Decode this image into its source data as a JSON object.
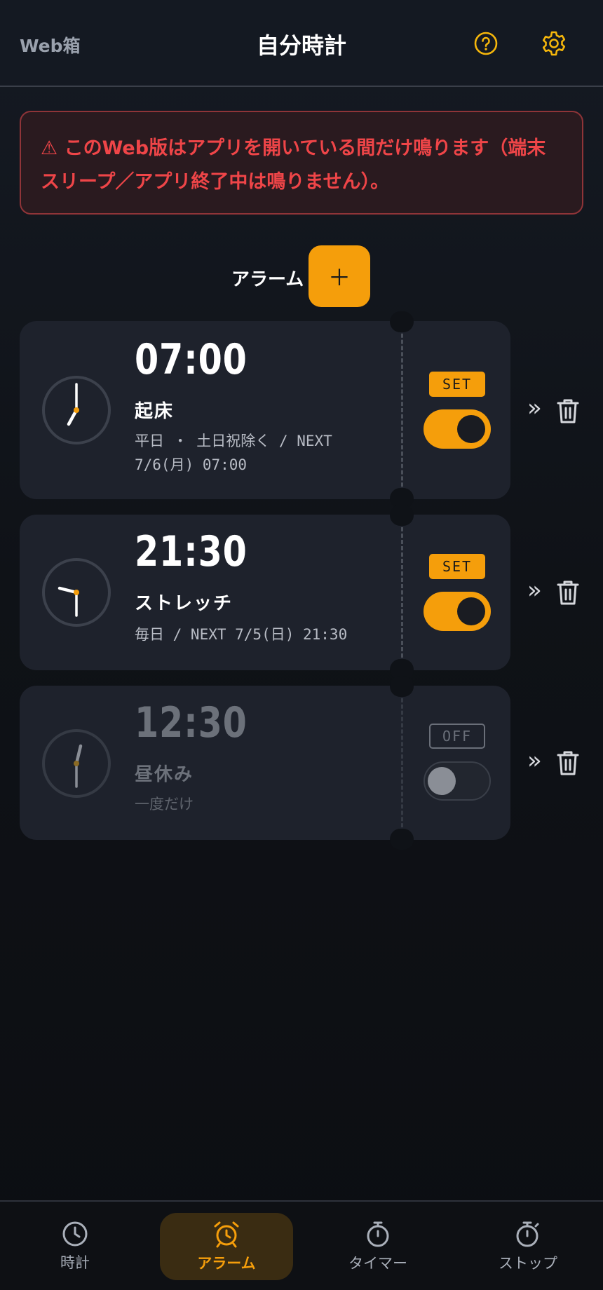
{
  "header": {
    "brand": "Web箱",
    "title": "自分時計",
    "help_icon": "help-circle-icon",
    "settings_icon": "gear-icon"
  },
  "warning": {
    "icon": "⚠",
    "text": "⚠ このWeb版はアプリを開いている間だけ鳴ります（端末スリープ／アプリ終了中は鳴りません）。"
  },
  "section": {
    "label": "アラーム",
    "add_label": "＋"
  },
  "alarms": [
    {
      "time": "07:00",
      "name": "起床",
      "schedule": "平日 ・ 土日祝除く / NEXT 7/6(月) 07:00",
      "badge": "SET",
      "enabled": true
    },
    {
      "time": "21:30",
      "name": "ストレッチ",
      "schedule": "毎日 / NEXT 7/5(日) 21:30",
      "badge": "SET",
      "enabled": true
    },
    {
      "time": "12:30",
      "name": "昼休み",
      "schedule": "一度だけ",
      "badge": "OFF",
      "enabled": false
    }
  ],
  "row_actions": {
    "chevron": "»",
    "delete_icon": "trash-icon"
  },
  "nav": {
    "items": [
      {
        "label": "時計",
        "icon": "clock-icon"
      },
      {
        "label": "アラーム",
        "icon": "alarm-clock-icon",
        "active": true
      },
      {
        "label": "タイマー",
        "icon": "timer-icon"
      },
      {
        "label": "ストップ",
        "icon": "stopwatch-icon"
      }
    ]
  },
  "colors": {
    "accent": "#f59e0b",
    "danger": "#ef4548",
    "card": "#1e222c"
  }
}
